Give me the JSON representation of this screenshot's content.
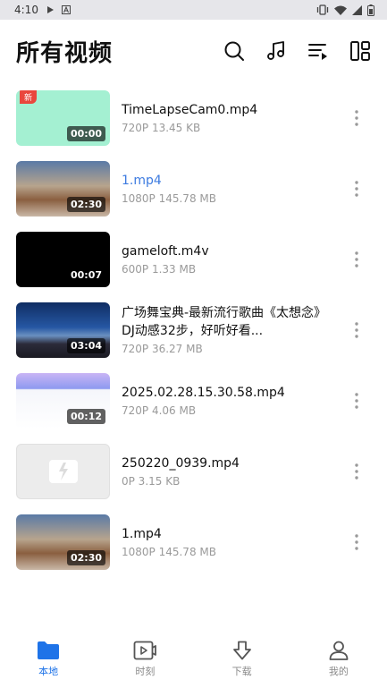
{
  "status": {
    "time": "4:10"
  },
  "header": {
    "title": "所有视频"
  },
  "videos": [
    {
      "name": "TimeLapseCam0.mp4",
      "meta": "720P 13.45 KB",
      "duration": "00:00",
      "badge": "新"
    },
    {
      "name": "1.mp4",
      "meta": "1080P 145.78 MB",
      "duration": "02:30"
    },
    {
      "name": "gameloft.m4v",
      "meta": "600P 1.33 MB",
      "duration": "00:07"
    },
    {
      "name": "广场舞宝典-最新流行歌曲《太想念》DJ动感32步，好听好看...",
      "meta": "720P 36.27 MB",
      "duration": "03:04"
    },
    {
      "name": "2025.02.28.15.30.58.mp4",
      "meta": "720P 4.06 MB",
      "duration": "00:12"
    },
    {
      "name": "250220_0939.mp4",
      "meta": "0P 3.15 KB"
    },
    {
      "name": "1.mp4",
      "meta": "1080P 145.78 MB",
      "duration": "02:30"
    }
  ],
  "tabs": [
    {
      "label": "本地",
      "icon": "folder-icon"
    },
    {
      "label": "时刻",
      "icon": "video-clip-icon"
    },
    {
      "label": "下载",
      "icon": "download-icon"
    },
    {
      "label": "我的",
      "icon": "person-icon"
    }
  ],
  "colors": {
    "accent": "#1e73e8",
    "playing_title": "#3d7be0",
    "new_badge": "#e9473d"
  }
}
